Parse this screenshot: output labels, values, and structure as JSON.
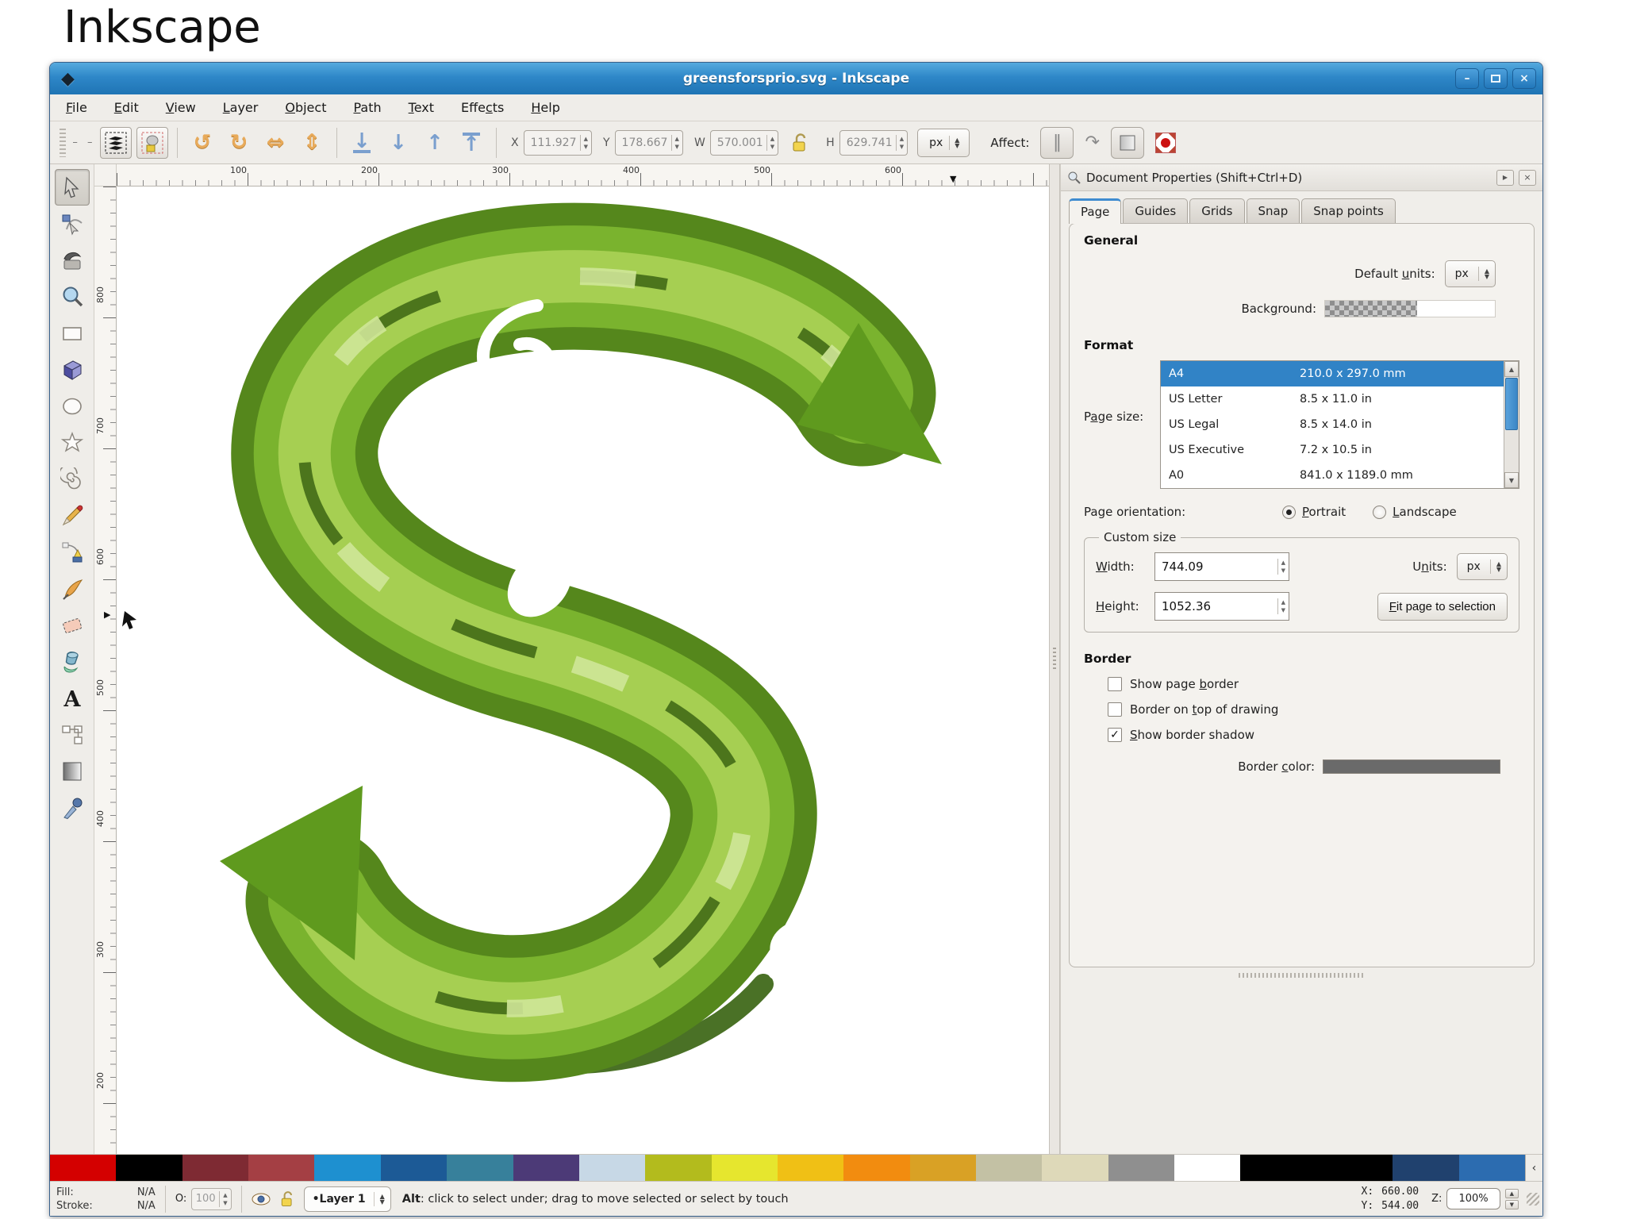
{
  "page": {
    "heading": "Inkscape"
  },
  "window": {
    "title": "greensforsprio.svg - Inkscape",
    "menu": [
      "File",
      "Edit",
      "View",
      "Layer",
      "Object",
      "Path",
      "Text",
      "Effects",
      "Help"
    ]
  },
  "toolbar": {
    "x_label": "X",
    "x_value": "111.927",
    "y_label": "Y",
    "y_value": "178.667",
    "w_label": "W",
    "w_value": "570.001",
    "h_label": "H",
    "h_value": "629.741",
    "unit_value": "px",
    "affect_label": "Affect:"
  },
  "toolbox": {
    "tools": [
      "selector-tool",
      "node-tool",
      "tweak-tool",
      "zoom-tool",
      "rectangle-tool",
      "box-3d-tool",
      "ellipse-tool",
      "star-tool",
      "spiral-tool",
      "pencil-tool",
      "pen-tool",
      "calligraphy-tool",
      "eraser-tool",
      "paint-bucket-tool",
      "text-tool",
      "connector-tool",
      "gradient-tool",
      "dropper-tool"
    ]
  },
  "rulers": {
    "h": [
      "100",
      "200",
      "300",
      "400",
      "500",
      "600"
    ],
    "v": [
      "800",
      "700",
      "600",
      "500",
      "400",
      "300",
      "200"
    ]
  },
  "panel": {
    "title": "Document Properties (Shift+Ctrl+D)",
    "tabs": [
      "Page",
      "Guides",
      "Grids",
      "Snap",
      "Snap points"
    ],
    "active_tab": "Page",
    "general": {
      "heading": "General",
      "default_units_label": "Default units:",
      "default_units_value": "px",
      "background_label": "Background:"
    },
    "format": {
      "heading": "Format",
      "page_size_label": "Page size:",
      "sizes": [
        {
          "name": "A4",
          "dims": "210.0 x 297.0 mm",
          "selected": true
        },
        {
          "name": "US Letter",
          "dims": "8.5 x 11.0 in",
          "selected": false
        },
        {
          "name": "US Legal",
          "dims": "8.5 x 14.0 in",
          "selected": false
        },
        {
          "name": "US Executive",
          "dims": "7.2 x 10.5 in",
          "selected": false
        },
        {
          "name": "A0",
          "dims": "841.0 x 1189.0 mm",
          "selected": false
        }
      ],
      "orientation_label": "Page orientation:",
      "portrait": "Portrait",
      "landscape": "Landscape",
      "orientation_value": "Portrait"
    },
    "custom_size": {
      "legend": "Custom size",
      "width_label": "Width:",
      "width_value": "744.09",
      "units_label": "Units:",
      "units_value": "px",
      "height_label": "Height:",
      "height_value": "1052.36",
      "fit_button": "Fit page to selection"
    },
    "border": {
      "heading": "Border",
      "checkboxes": [
        {
          "label": "Show page border",
          "mark": ""
        },
        {
          "label": "Border on top of drawing",
          "mark": ""
        },
        {
          "label": "Show border shadow",
          "mark": "✓"
        }
      ],
      "border_color_label": "Border color:",
      "border_color": "#6a6a6a"
    }
  },
  "palette": {
    "colors": [
      "#d40000",
      "#000000",
      "#7e2a33",
      "#a43f44",
      "#1e90d0",
      "#1c5a96",
      "#37809b",
      "#4c3a77",
      "#c7d8e6",
      "#b3bb1d",
      "#e6e62e",
      "#f0c015",
      "#f28c0f",
      "#d9a125",
      "#c3c1a4",
      "#ded9b9",
      "#8f8f8f",
      "#ffffff",
      "#000000",
      "#20416e",
      "#2c6cb0"
    ]
  },
  "statusbar": {
    "fill_label": "Fill:",
    "fill_value": "N/A",
    "stroke_label": "Stroke:",
    "stroke_value": "N/A",
    "opacity_label": "O:",
    "opacity_value": "100",
    "layer_value": "Layer 1",
    "hint_bold": "Alt",
    "hint_rest": ": click to select under; drag to move selected or select by touch",
    "x_label": "X:",
    "x_value": "660.00",
    "y_label": "Y:",
    "y_value": "544.00",
    "zoom_label": "Z:",
    "zoom_value": "100%"
  },
  "icons": {
    "logo": "◆",
    "minimize": "–",
    "close": "×",
    "panel_forward": "▶",
    "panel_close": "×",
    "rotate_ccw": "↺",
    "rotate_cw": "↻",
    "flip_horizontal": "⇔",
    "flip_vertical": "⇕",
    "lower_to_bottom": "↓",
    "lower_one_step": "↓",
    "raise_one_step": "↑",
    "raise_to_top": "↑",
    "affect_move": "‖",
    "affect_rotate": "↷",
    "spin_up": "▲",
    "spin_down": "▼",
    "ruler_marker_h": "▼",
    "ruler_marker_v": "▶",
    "palette_prev": "‹",
    "bullet": "•"
  }
}
